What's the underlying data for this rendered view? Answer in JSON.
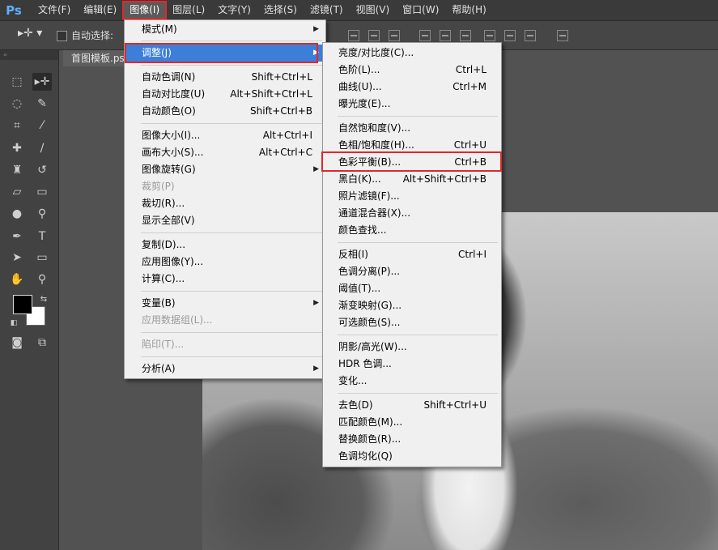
{
  "app": {
    "logo": "Ps",
    "accent": "#3c7fd9",
    "highlight_box_color": "#e0282a"
  },
  "menubar": [
    {
      "label": "文件(F)"
    },
    {
      "label": "编辑(E)"
    },
    {
      "label": "图像(I)"
    },
    {
      "label": "图层(L)"
    },
    {
      "label": "文字(Y)"
    },
    {
      "label": "选择(S)"
    },
    {
      "label": "滤镜(T)"
    },
    {
      "label": "视图(V)"
    },
    {
      "label": "窗口(W)"
    },
    {
      "label": "帮助(H)"
    }
  ],
  "options_bar": {
    "auto_select_label": "自动选择:"
  },
  "document": {
    "tab_label": "首图模板.ps"
  },
  "image_menu": {
    "items": [
      {
        "label": "模式(M)",
        "shortcut": "",
        "submenu": true
      },
      {
        "label": "调整(J)",
        "shortcut": "",
        "submenu": true,
        "highlighted": true
      },
      {
        "label": "自动色调(N)",
        "shortcut": "Shift+Ctrl+L"
      },
      {
        "label": "自动对比度(U)",
        "shortcut": "Alt+Shift+Ctrl+L"
      },
      {
        "label": "自动颜色(O)",
        "shortcut": "Shift+Ctrl+B"
      },
      {
        "label": "图像大小(I)...",
        "shortcut": "Alt+Ctrl+I"
      },
      {
        "label": "画布大小(S)...",
        "shortcut": "Alt+Ctrl+C"
      },
      {
        "label": "图像旋转(G)",
        "shortcut": "",
        "submenu": true
      },
      {
        "label": "裁剪(P)",
        "shortcut": "",
        "disabled": true
      },
      {
        "label": "裁切(R)...",
        "shortcut": ""
      },
      {
        "label": "显示全部(V)",
        "shortcut": ""
      },
      {
        "label": "复制(D)...",
        "shortcut": ""
      },
      {
        "label": "应用图像(Y)...",
        "shortcut": ""
      },
      {
        "label": "计算(C)...",
        "shortcut": ""
      },
      {
        "label": "变量(B)",
        "shortcut": "",
        "submenu": true
      },
      {
        "label": "应用数据组(L)...",
        "shortcut": "",
        "disabled": true
      },
      {
        "label": "陷印(T)...",
        "shortcut": "",
        "disabled": true
      },
      {
        "label": "分析(A)",
        "shortcut": "",
        "submenu": true
      }
    ]
  },
  "adjust_menu": {
    "items": [
      {
        "label": "亮度/对比度(C)...",
        "shortcut": ""
      },
      {
        "label": "色阶(L)...",
        "shortcut": "Ctrl+L"
      },
      {
        "label": "曲线(U)...",
        "shortcut": "Ctrl+M"
      },
      {
        "label": "曝光度(E)...",
        "shortcut": ""
      },
      {
        "label": "自然饱和度(V)...",
        "shortcut": ""
      },
      {
        "label": "色相/饱和度(H)...",
        "shortcut": "Ctrl+U"
      },
      {
        "label": "色彩平衡(B)...",
        "shortcut": "Ctrl+B",
        "boxed": true
      },
      {
        "label": "黑白(K)...",
        "shortcut": "Alt+Shift+Ctrl+B"
      },
      {
        "label": "照片滤镜(F)...",
        "shortcut": ""
      },
      {
        "label": "通道混合器(X)...",
        "shortcut": ""
      },
      {
        "label": "颜色查找...",
        "shortcut": ""
      },
      {
        "label": "反相(I)",
        "shortcut": "Ctrl+I"
      },
      {
        "label": "色调分离(P)...",
        "shortcut": ""
      },
      {
        "label": "阈值(T)...",
        "shortcut": ""
      },
      {
        "label": "渐变映射(G)...",
        "shortcut": ""
      },
      {
        "label": "可选颜色(S)...",
        "shortcut": ""
      },
      {
        "label": "阴影/高光(W)...",
        "shortcut": ""
      },
      {
        "label": "HDR 色调...",
        "shortcut": ""
      },
      {
        "label": "变化...",
        "shortcut": ""
      },
      {
        "label": "去色(D)",
        "shortcut": "Shift+Ctrl+U"
      },
      {
        "label": "匹配颜色(M)...",
        "shortcut": ""
      },
      {
        "label": "替换颜色(R)...",
        "shortcut": ""
      },
      {
        "label": "色调均化(Q)",
        "shortcut": ""
      }
    ]
  },
  "tools": [
    {
      "icon": "marquee-icon"
    },
    {
      "icon": "move-icon"
    },
    {
      "icon": "lasso-icon"
    },
    {
      "icon": "quick-select-icon"
    },
    {
      "icon": "crop-icon"
    },
    {
      "icon": "eyedropper-icon"
    },
    {
      "icon": "healing-brush-icon"
    },
    {
      "icon": "brush-icon"
    },
    {
      "icon": "clone-stamp-icon"
    },
    {
      "icon": "history-brush-icon"
    },
    {
      "icon": "eraser-icon"
    },
    {
      "icon": "gradient-icon"
    },
    {
      "icon": "blur-icon"
    },
    {
      "icon": "dodge-icon"
    },
    {
      "icon": "pen-icon"
    },
    {
      "icon": "type-icon"
    },
    {
      "icon": "path-select-icon"
    },
    {
      "icon": "rectangle-icon"
    },
    {
      "icon": "hand-icon"
    },
    {
      "icon": "zoom-icon"
    }
  ],
  "type_tool_glyph": "T"
}
